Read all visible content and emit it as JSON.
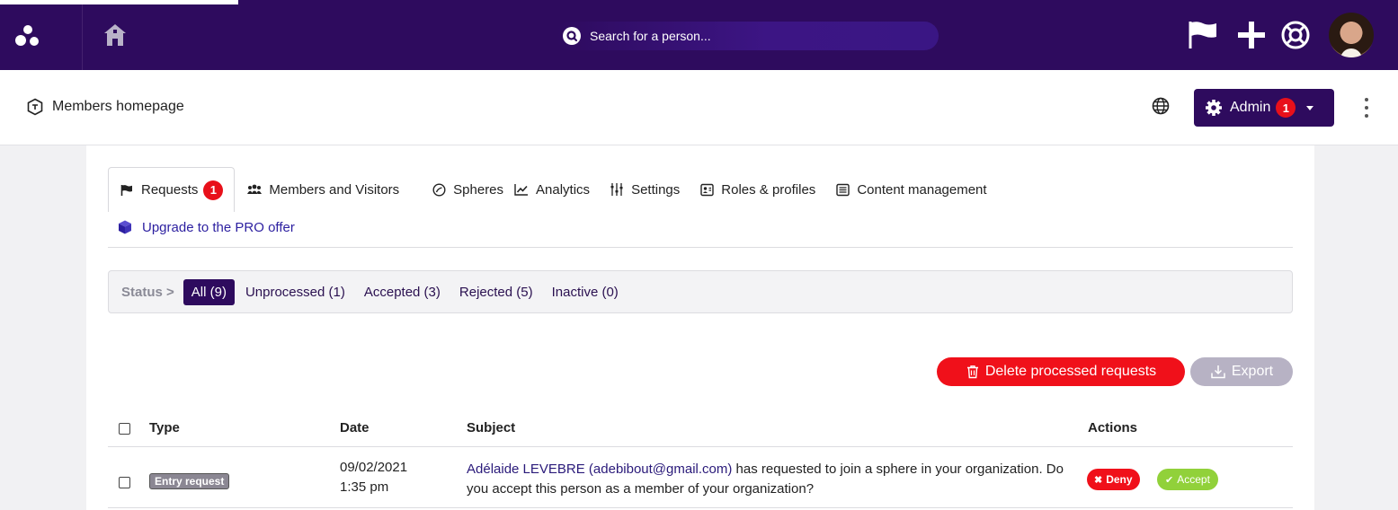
{
  "topbar": {
    "search_placeholder": "Search for a person...",
    "icons": [
      "logo-icon",
      "home-icon",
      "search-icon",
      "flag-icon",
      "plus-icon",
      "help-icon",
      "avatar"
    ]
  },
  "subbar": {
    "page_title": "Members homepage",
    "admin_label": "Admin",
    "admin_badge": "1"
  },
  "tabs": [
    {
      "label": "Requests",
      "badge": "1",
      "icon": "flag-icon"
    },
    {
      "label": "Members and Visitors",
      "icon": "people-icon"
    },
    {
      "label": "Spheres",
      "icon": "sphere-icon"
    },
    {
      "label": "Analytics",
      "icon": "chart-icon"
    },
    {
      "label": "Settings",
      "icon": "sliders-icon"
    },
    {
      "label": "Roles & profiles",
      "icon": "id-card-icon"
    },
    {
      "label": "Content management",
      "icon": "list-icon"
    }
  ],
  "upgrade_label": "Upgrade to the PRO offer",
  "filter": {
    "label": "Status >",
    "items": [
      "All (9)",
      "Unprocessed (1)",
      "Accepted (3)",
      "Rejected (5)",
      "Inactive (0)"
    ]
  },
  "actions": {
    "delete_label": "Delete processed requests",
    "export_label": "Export"
  },
  "table": {
    "headers": {
      "type": "Type",
      "date": "Date",
      "subject": "Subject",
      "actions": "Actions"
    },
    "rows": [
      {
        "type": "Entry request",
        "date": "09/02/2021",
        "time": "1:35 pm",
        "subject_name": "Adélaide LEVEBRE (adebibout@gmail.com)",
        "subject_rest": " has requested to join a sphere in your organization. Do you accept this person as a member of your organization?",
        "deny_label": "Deny",
        "accept_label": "Accept"
      }
    ]
  },
  "colors": {
    "brand": "#2e0b5e",
    "danger": "#f0101a",
    "success": "#91d13a",
    "link": "#2c1fa0"
  }
}
